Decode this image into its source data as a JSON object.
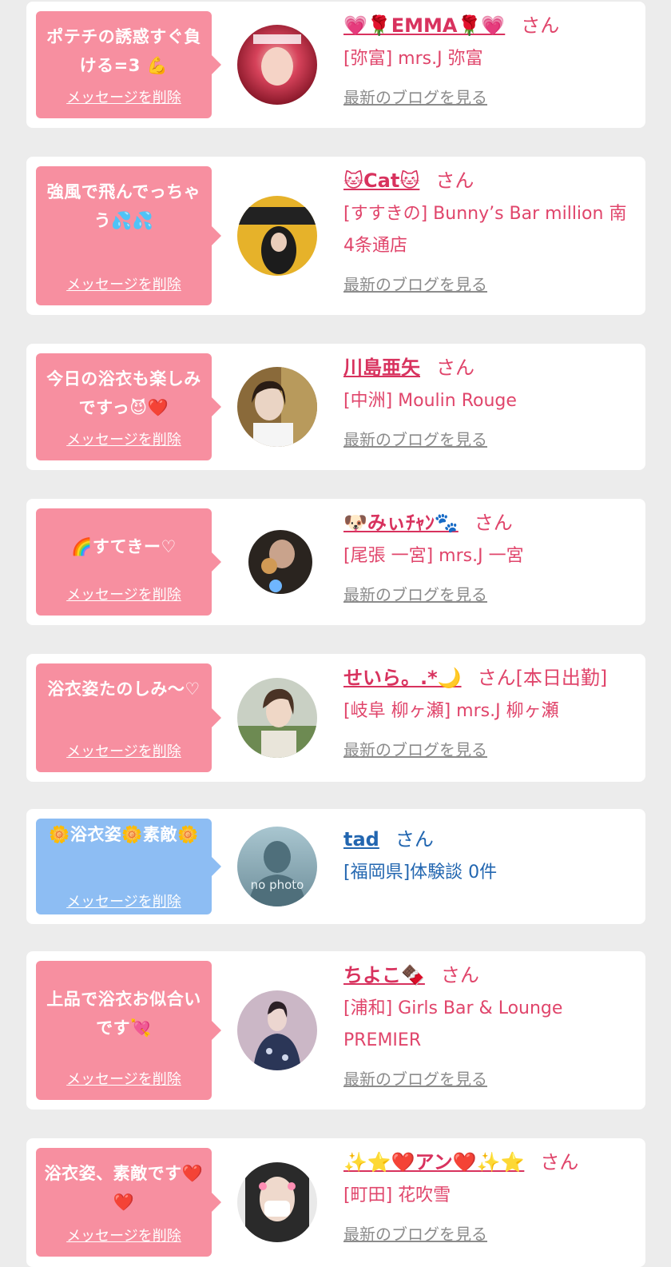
{
  "common": {
    "delete_label": "メッセージを削除",
    "blog_label": "最新のブログを見る",
    "san": "さん"
  },
  "cards": [
    {
      "message": "ポテチの誘惑すぐ負ける=3 💪",
      "name": "💗🌹EMMA🌹💗",
      "san_suffix": "",
      "shop": "[弥富] mrs.J 弥富",
      "blog": true,
      "theme": "pink"
    },
    {
      "message": "強風で飛んでっちゃう💦💦",
      "name": "🐱Cat🐱",
      "san_suffix": "",
      "shop": "[すすきの] Bunny’s Bar million 南4条通店",
      "blog": true,
      "theme": "pink"
    },
    {
      "message": "今日の浴衣も楽しみですっ😈❤️",
      "name": "川島亜矢",
      "san_suffix": "",
      "shop": "[中洲] Moulin Rouge",
      "blog": true,
      "theme": "pink"
    },
    {
      "message": "🌈すてきー♡",
      "name": "🐶みぃﾁｬﾝ🐾",
      "san_suffix": "",
      "shop": "[尾張 一宮] mrs.J 一宮",
      "blog": true,
      "theme": "pink"
    },
    {
      "message": "浴衣姿たのしみ〜♡",
      "name": "せいら。.*🌙",
      "san_suffix": "[本日出勤]",
      "shop": "[岐阜 柳ヶ瀬] mrs.J 柳ヶ瀬",
      "blog": true,
      "theme": "pink"
    },
    {
      "message": "🌼浴衣姿🌼素敵🌼",
      "name": "tad",
      "san_suffix": "",
      "shop": "[福岡県]体験談 0件",
      "blog": false,
      "theme": "blue",
      "avatar_text": "no photo"
    },
    {
      "message": "上品で浴衣お似合いです💘",
      "name": "ちよこ🍫",
      "san_suffix": "",
      "shop": "[浦和] Girls Bar & Lounge PREMIER",
      "blog": true,
      "theme": "pink"
    },
    {
      "message": "浴衣姿、素敵です❤️❤️",
      "name": "✨⭐❤️アン❤️✨⭐",
      "san_suffix": "",
      "shop": "[町田] 花吹雪",
      "blog": true,
      "theme": "pink"
    }
  ],
  "colors": {
    "pink_bubble": "#f78fa0",
    "blue_bubble": "#8dbdf3",
    "name_pink": "#d8325e",
    "name_blue": "#2266b0"
  }
}
